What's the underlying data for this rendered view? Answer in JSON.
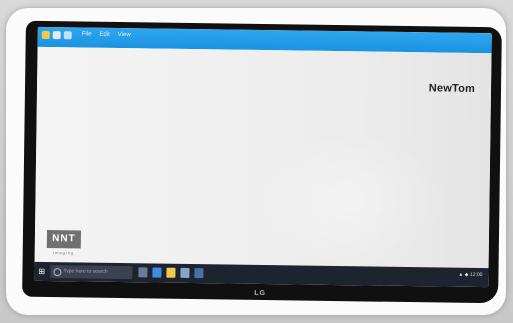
{
  "screen": {
    "title_menu": [
      "File",
      "Edit",
      "View"
    ],
    "brand": "NewTom",
    "logo": {
      "text": "NNT",
      "subtitle": "imaging"
    },
    "taskbar": {
      "search_placeholder": "Type here to search",
      "tray_text": "▲ ◆ 12:00"
    }
  },
  "monitor": {
    "brand": "LG"
  },
  "colors": {
    "titlebar": "#1a93e2",
    "taskbar": "#1d2430",
    "screen_bg": "#f0f0f0"
  },
  "icons": [
    "folder-icon",
    "save-icon",
    "help-icon",
    "windows-start-icon",
    "search-icon",
    "task-view-icon",
    "edge-icon",
    "explorer-icon",
    "store-icon",
    "mail-icon"
  ]
}
